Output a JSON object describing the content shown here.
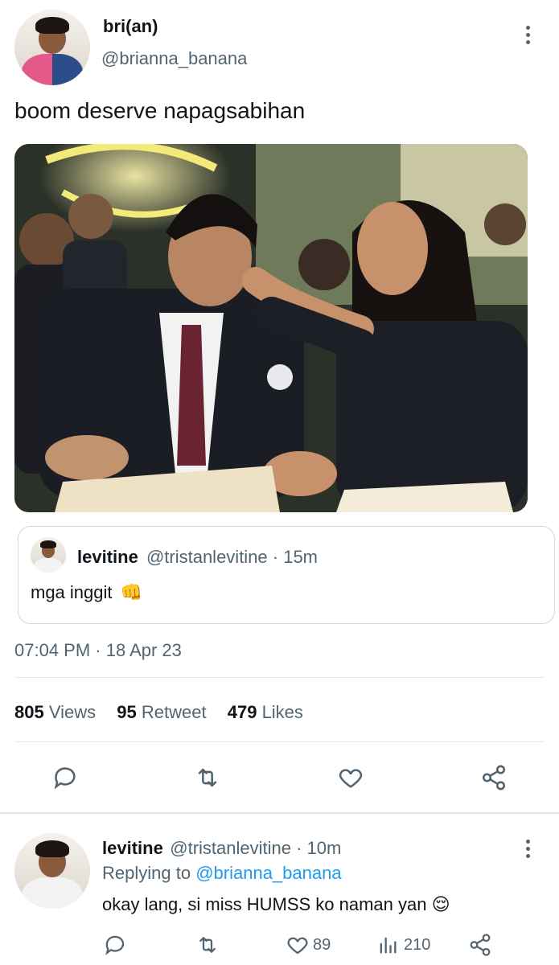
{
  "tweet": {
    "display_name": "bri(an)",
    "handle": "@brianna_banana",
    "text": "boom deserve napagsabihan",
    "timestamp": "07:04 PM · 18 Apr 23"
  },
  "quote": {
    "display_name": "levitine",
    "handle_time": "@tristanlevitine · 15m",
    "text": "mga inggit",
    "emoji": "👊"
  },
  "stats": {
    "views_num": "805",
    "views_label": "Views",
    "retweets_num": "95",
    "retweets_label": "Retweet",
    "likes_num": "479",
    "likes_label": "Likes"
  },
  "icons": [
    "reply-icon",
    "retweet-icon",
    "like-icon",
    "share-icon",
    "more-icon",
    "views-icon"
  ],
  "reply": {
    "display_name": "levitine",
    "handle_time": "@tristanlevitine · 10m",
    "replying_prefix": "Replying to",
    "replying_to": "@brianna_banana",
    "text": "okay lang, si miss HUMSS ko naman yan",
    "emoji": "😌",
    "likes": "89",
    "views": "210"
  },
  "colors": {
    "accent": "#1d9bf0",
    "muted": "#536471",
    "text": "#0f1419",
    "border": "#cfd9de"
  }
}
